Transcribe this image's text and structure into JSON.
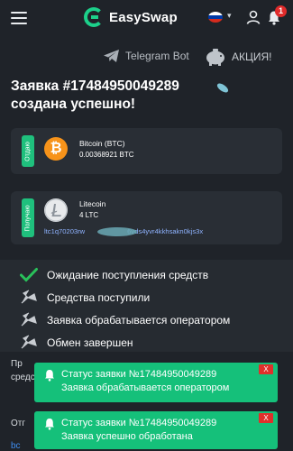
{
  "header": {
    "brand": "EasySwap",
    "flag_colors": [
      "#ffffff",
      "#0039a6",
      "#d52b1e"
    ],
    "language_caret": "▾",
    "notifications_count": "1",
    "accent_color": "#1cd08a"
  },
  "promo": {
    "telegram_label": "Telegram Bot",
    "akcia_label": "АКЦИЯ!"
  },
  "order": {
    "title_line1": "Заявка #17484950049289",
    "title_line2": "создана успешно!"
  },
  "give": {
    "side_label": "Отдаю",
    "coin_symbol": "₿",
    "coin_name": "Bitcoin (BTC)",
    "amount": "0.00368921 BTC"
  },
  "get": {
    "side_label": "Получаю",
    "coin_name": "Litecoin",
    "amount": "4 LTC",
    "address_start": "ltc1q70203rw",
    "address_end": "6vds4yvr4kkhsakn0kjs3x"
  },
  "statuses": [
    {
      "label": "Ожидание поступления средств",
      "state": "done"
    },
    {
      "label": "Средства поступили",
      "state": "pending"
    },
    {
      "label": "Заявка обрабатывается оператором",
      "state": "pending"
    },
    {
      "label": "Обмен завершен",
      "state": "pending"
    }
  ],
  "below": {
    "line1": "Пр",
    "line2": "средств",
    "line3": "Отг",
    "line4": "bc"
  },
  "toasts": [
    {
      "line1": "Статус заявки №17484950049289",
      "line2": "Заявка обрабатывается оператором",
      "close": "X"
    },
    {
      "line1": "Статус заявки №17484950049289",
      "line2": "Заявка успешно обработана",
      "close": "X"
    }
  ]
}
